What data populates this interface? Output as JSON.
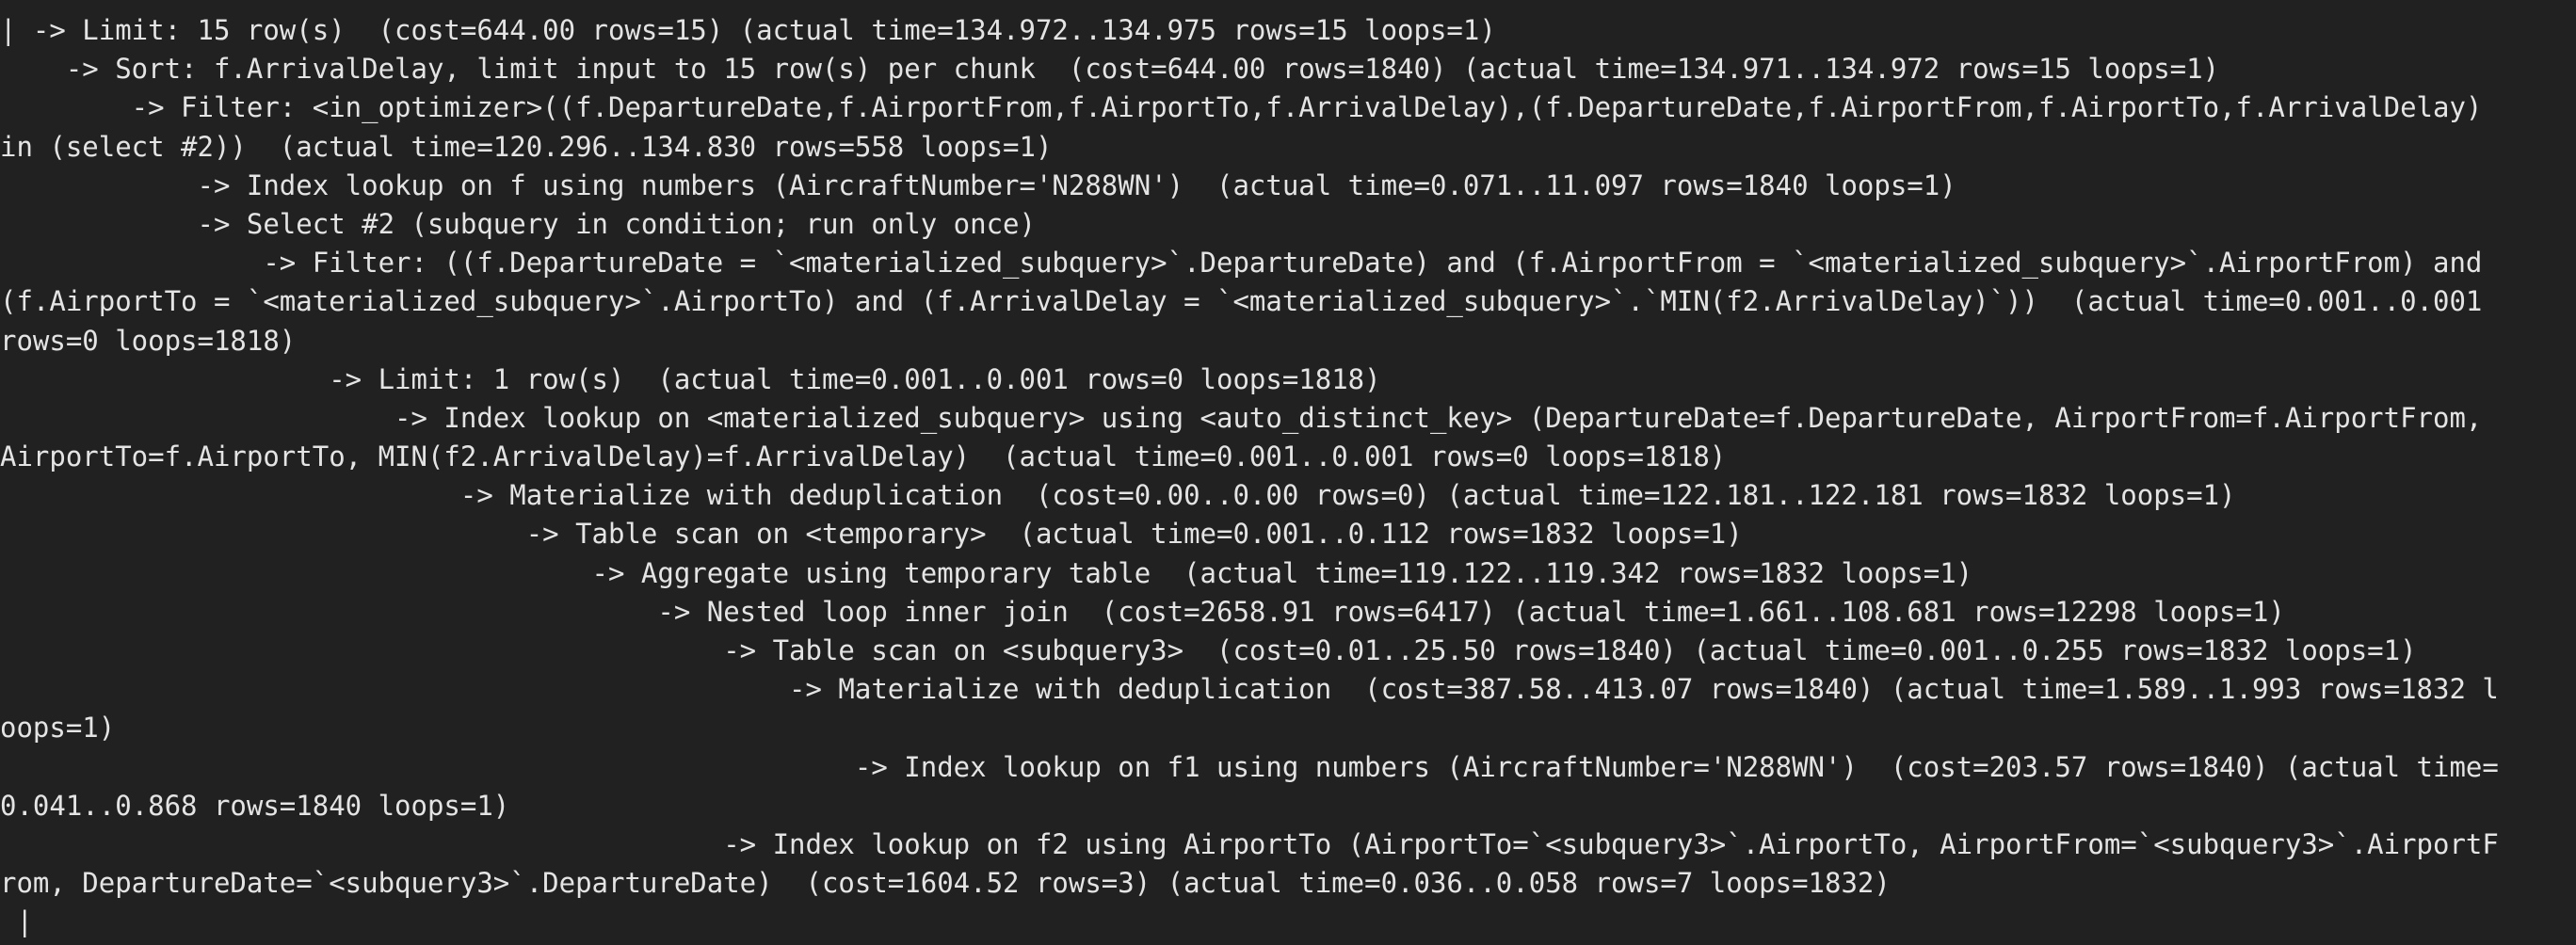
{
  "terminal": {
    "lines": [
      "| -> Limit: 15 row(s)  (cost=644.00 rows=15) (actual time=134.972..134.975 rows=15 loops=1)",
      "    -> Sort: f.ArrivalDelay, limit input to 15 row(s) per chunk  (cost=644.00 rows=1840) (actual time=134.971..134.972 rows=15 loops=1)",
      "        -> Filter: <in_optimizer>((f.DepartureDate,f.AirportFrom,f.AirportTo,f.ArrivalDelay),(f.DepartureDate,f.AirportFrom,f.AirportTo,f.ArrivalDelay)",
      "in (select #2))  (actual time=120.296..134.830 rows=558 loops=1)",
      "            -> Index lookup on f using numbers (AircraftNumber='N288WN')  (actual time=0.071..11.097 rows=1840 loops=1)",
      "            -> Select #2 (subquery in condition; run only once)",
      "                -> Filter: ((f.DepartureDate = `<materialized_subquery>`.DepartureDate) and (f.AirportFrom = `<materialized_subquery>`.AirportFrom) and",
      "(f.AirportTo = `<materialized_subquery>`.AirportTo) and (f.ArrivalDelay = `<materialized_subquery>`.`MIN(f2.ArrivalDelay)`))  (actual time=0.001..0.001",
      "rows=0 loops=1818)",
      "                    -> Limit: 1 row(s)  (actual time=0.001..0.001 rows=0 loops=1818)",
      "                        -> Index lookup on <materialized_subquery> using <auto_distinct_key> (DepartureDate=f.DepartureDate, AirportFrom=f.AirportFrom,",
      "AirportTo=f.AirportTo, MIN(f2.ArrivalDelay)=f.ArrivalDelay)  (actual time=0.001..0.001 rows=0 loops=1818)",
      "                            -> Materialize with deduplication  (cost=0.00..0.00 rows=0) (actual time=122.181..122.181 rows=1832 loops=1)",
      "                                -> Table scan on <temporary>  (actual time=0.001..0.112 rows=1832 loops=1)",
      "                                    -> Aggregate using temporary table  (actual time=119.122..119.342 rows=1832 loops=1)",
      "                                        -> Nested loop inner join  (cost=2658.91 rows=6417) (actual time=1.661..108.681 rows=12298 loops=1)",
      "                                            -> Table scan on <subquery3>  (cost=0.01..25.50 rows=1840) (actual time=0.001..0.255 rows=1832 loops=1)",
      "                                                -> Materialize with deduplication  (cost=387.58..413.07 rows=1840) (actual time=1.589..1.993 rows=1832 l",
      "oops=1)",
      "                                                    -> Index lookup on f1 using numbers (AircraftNumber='N288WN')  (cost=203.57 rows=1840) (actual time=",
      "0.041..0.868 rows=1840 loops=1)",
      "                                            -> Index lookup on f2 using AirportTo (AirportTo=`<subquery3>`.AirportTo, AirportFrom=`<subquery3>`.AirportF",
      "rom, DepartureDate=`<subquery3>`.DepartureDate)  (cost=1604.52 rows=3) (actual time=0.036..0.058 rows=7 loops=1832)"
    ],
    "last_line": " |"
  }
}
